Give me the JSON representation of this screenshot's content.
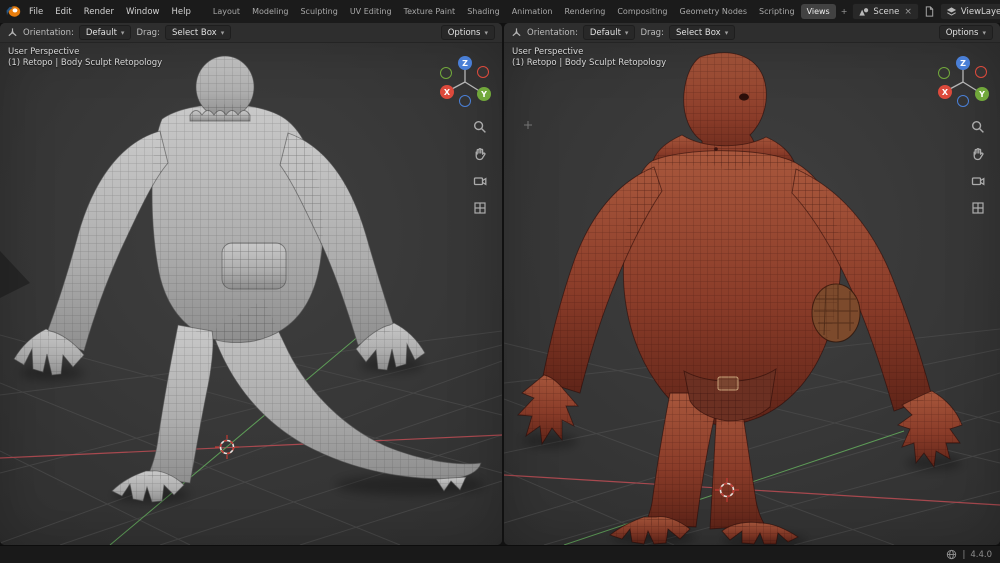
{
  "topbar": {
    "menus": [
      "File",
      "Edit",
      "Render",
      "Window",
      "Help"
    ],
    "workspaces": [
      "Layout",
      "Modeling",
      "Sculpting",
      "UV Editing",
      "Texture Paint",
      "Shading",
      "Animation",
      "Rendering",
      "Compositing",
      "Geometry Nodes",
      "Scripting",
      "Views"
    ],
    "active_workspace": "Views",
    "add_workspace_label": "+",
    "scene": {
      "name": "Scene"
    },
    "view_layer": {
      "name": "ViewLayer"
    }
  },
  "viewport_left": {
    "header": {
      "orientation_label": "Orientation:",
      "orientation_value": "Default",
      "drag_label": "Drag:",
      "drag_value": "Select Box",
      "options_label": "Options"
    },
    "overlay": {
      "view_mode": "User Perspective",
      "active_object": "(1) Retopo | Body Sculpt Retopology"
    },
    "model_description": "Gray sculpted reptilian creature seen from behind with retopology wireframe and back pouch"
  },
  "viewport_right": {
    "header": {
      "orientation_label": "Orientation:",
      "orientation_value": "Default",
      "drag_label": "Drag:",
      "drag_value": "Select Box",
      "options_label": "Options"
    },
    "overlay": {
      "view_mode": "User Perspective",
      "active_object": "(1) Retopo | Body Sculpt Retopology"
    },
    "model_description": "Red-brown muscular reptilian creature seen from front with wireframe overlay and hip pouch"
  },
  "gizmo": {
    "x_label": "X",
    "y_label": "Y",
    "z_label": "Z"
  },
  "icons": {
    "chevron_down": "▾",
    "close": "×"
  },
  "statusbar": {
    "separator": "|",
    "version": "4.4.0"
  },
  "colors": {
    "accent": "#4772b3",
    "axis_x": "#dd4a3c",
    "axis_y": "#71a83b",
    "axis_z": "#4a7fd6",
    "model_left": "#b9b9b9",
    "model_right": "#8e412d",
    "viewport_bg": "#3c3c3c"
  }
}
